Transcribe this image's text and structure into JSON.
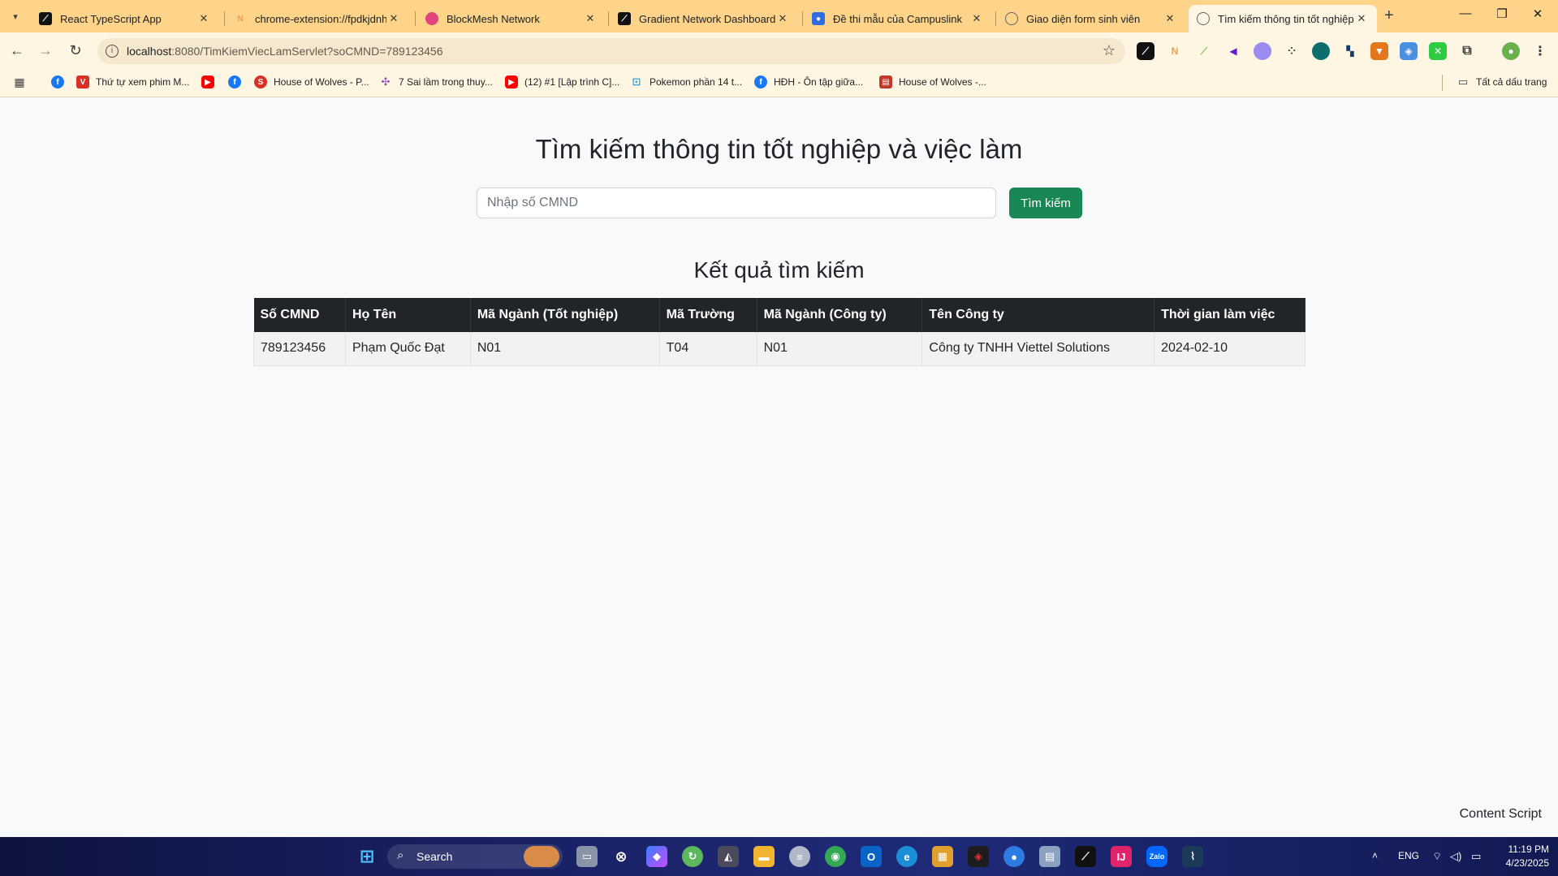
{
  "browser": {
    "tabs": [
      {
        "title": "React TypeScript App",
        "icon": "react-icon",
        "color": "#111111",
        "active": false
      },
      {
        "title": "chrome-extension://fpdkjdnhkakefebpekbdhillbhonfjjp/index.html",
        "icon": "extension-icon",
        "color": "#f0a050",
        "active": false
      },
      {
        "title": "BlockMesh Network",
        "icon": "blockmesh-icon",
        "color": "#e0457b",
        "active": false
      },
      {
        "title": "Gradient Network Dashboard",
        "icon": "gradient-icon",
        "color": "#111111",
        "active": false
      },
      {
        "title": "Đề thi mẫu của Campuslink",
        "icon": "campuslink-icon",
        "color": "#2f6de1",
        "active": false
      },
      {
        "title": "Giao diện form sinh viên",
        "icon": "globe-icon",
        "color": "#5f6368",
        "active": false
      },
      {
        "title": "Tìm kiếm thông tin tốt nghiệp và việc làm",
        "icon": "globe-icon",
        "color": "#5f6368",
        "active": true
      }
    ],
    "url_host": "localhost",
    "url_path": ":8080/TimKiemViecLamServlet?soCMND=789123456",
    "bookmarks": [
      {
        "label": "",
        "icon": "apps-icon",
        "color": "#3c3c3c"
      },
      {
        "label": "",
        "icon": "facebook-icon",
        "color": "#1877f2"
      },
      {
        "label": "Thứ tự xem phim M...",
        "icon": "bookmark-v-icon",
        "color": "#d93025"
      },
      {
        "label": "",
        "icon": "youtube-icon",
        "color": "#ff0000"
      },
      {
        "label": "",
        "icon": "facebook-icon",
        "color": "#1877f2"
      },
      {
        "label": "House of Wolves - P...",
        "icon": "s-red-icon",
        "color": "#d93025"
      },
      {
        "label": "7 Sai lầm trong thuy...",
        "icon": "pinwheel-icon",
        "color": "#8e44ad"
      },
      {
        "label": "(12) #1 [Lập trình C]...",
        "icon": "youtube-icon",
        "color": "#ff0000"
      },
      {
        "label": "Pokemon phần 14 t...",
        "icon": "tv-icon",
        "color": "#3aa0d8"
      },
      {
        "label": "HĐH - Ôn tập giữa...",
        "icon": "facebook-icon",
        "color": "#1877f2"
      },
      {
        "label": "House of Wolves -...",
        "icon": "flag-icon",
        "color": "#c0392b"
      }
    ],
    "all_bookmarks_label": "Tất cả dấu trang"
  },
  "page": {
    "title": "Tìm kiếm thông tin tốt nghiệp và việc làm",
    "search_placeholder": "Nhập số CMND",
    "search_button": "Tìm kiếm",
    "results_title": "Kết quả tìm kiếm",
    "table": {
      "headers": [
        "Số CMND",
        "Họ Tên",
        "Mã Ngành (Tốt nghiệp)",
        "Mã Trường",
        "Mã Ngành (Công ty)",
        "Tên Công ty",
        "Thời gian làm việc"
      ],
      "rows": [
        [
          "789123456",
          "Phạm Quốc Đạt",
          "N01",
          "T04",
          "N01",
          "Công ty TNHH Viettel Solutions",
          "2024-02-10"
        ]
      ]
    },
    "footer_note": "Content Script"
  },
  "taskbar": {
    "search_label": "Search",
    "language": "ENG",
    "time": "11:19 PM",
    "date": "4/23/2025"
  }
}
